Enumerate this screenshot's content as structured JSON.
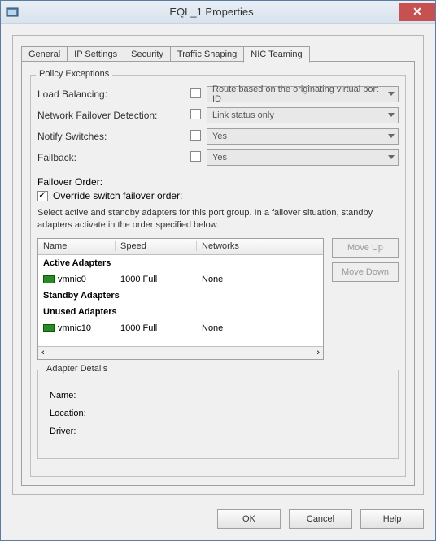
{
  "window": {
    "title": "EQL_1 Properties"
  },
  "tabs": [
    "General",
    "IP Settings",
    "Security",
    "Traffic Shaping",
    "NIC Teaming"
  ],
  "activeTab": 4,
  "policy": {
    "legend": "Policy Exceptions",
    "rows": {
      "loadBalancing": {
        "label": "Load Balancing:",
        "checked": false,
        "value": "Route based on the originating virtual port ID"
      },
      "failoverDetection": {
        "label": "Network Failover Detection:",
        "checked": false,
        "value": "Link status only"
      },
      "notifySwitches": {
        "label": "Notify Switches:",
        "checked": false,
        "value": "Yes"
      },
      "failback": {
        "label": "Failback:",
        "checked": false,
        "value": "Yes"
      }
    },
    "failoverOrderLabel": "Failover Order:",
    "overrideLabel": "Override switch failover order:",
    "overrideChecked": true,
    "helpText": "Select active and standby adapters for this port group.  In a failover situation, standby adapters activate  in the order specified below.",
    "columns": {
      "name": "Name",
      "speed": "Speed",
      "networks": "Networks"
    },
    "categories": {
      "active": "Active Adapters",
      "standby": "Standby Adapters",
      "unused": "Unused Adapters"
    },
    "adapters": {
      "active": [
        {
          "name": "vmnic0",
          "speed": "1000 Full",
          "networks": "None"
        }
      ],
      "standby": [],
      "unused": [
        {
          "name": "vmnic10",
          "speed": "1000 Full",
          "networks": "None"
        }
      ]
    },
    "buttons": {
      "moveUp": "Move Up",
      "moveDown": "Move Down"
    },
    "detailsLegend": "Adapter Details",
    "details": {
      "nameLabel": "Name:",
      "locationLabel": "Location:",
      "driverLabel": "Driver:"
    }
  },
  "footer": {
    "ok": "OK",
    "cancel": "Cancel",
    "help": "Help"
  }
}
